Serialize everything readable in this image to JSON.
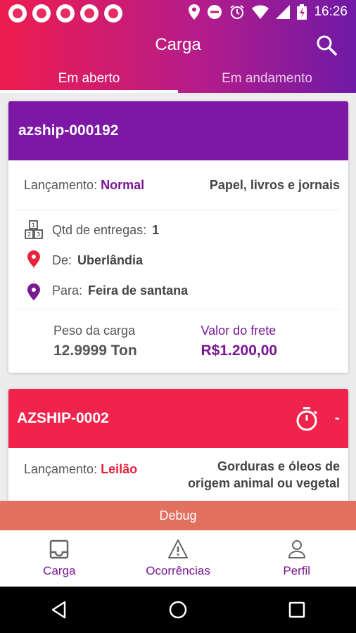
{
  "statusbar": {
    "time": "16:26",
    "left_icons": [
      "app-notification-icon",
      "app-notification-icon",
      "app-notification-icon",
      "app-notification-icon",
      "record-icon"
    ],
    "right_icons": [
      "location-icon",
      "do-not-disturb-icon",
      "alarm-icon",
      "wifi-icon",
      "signal-icon",
      "battery-icon"
    ]
  },
  "appbar": {
    "title": "Carga",
    "search_icon": "search-icon"
  },
  "tabs": [
    {
      "label": "Em aberto",
      "active": true
    },
    {
      "label": "Em andamento",
      "active": false
    }
  ],
  "cards": [
    {
      "id": "azship-000192",
      "header_color": "#7c18a5",
      "launch_label": "Lançamento:",
      "launch_type": "Normal",
      "category": "Papel, livros e jornais",
      "deliveries_label": "Qtd de entregas:",
      "deliveries_value": "1",
      "from_label": "De:",
      "from_value": "Uberlândia",
      "to_label": "Para:",
      "to_value": "Feira de santana",
      "weight_label": "Peso da carga",
      "weight_value": "12.9999 Ton",
      "freight_label": "Valor do frete",
      "freight_value": "R$1.200,00"
    },
    {
      "id": "AZSHIP-0002",
      "header_color": "#f0234c",
      "timer_value": "-",
      "launch_label": "Lançamento:",
      "launch_type": "Leilão",
      "category_line1": "Gorduras e óleos de",
      "category_line2": "origem animal ou vegetal"
    }
  ],
  "debug": {
    "label": "Debug"
  },
  "bottom_nav": [
    {
      "label": "Carga",
      "icon": "inbox-icon"
    },
    {
      "label": "Ocorrências",
      "icon": "warning-icon"
    },
    {
      "label": "Perfil",
      "icon": "person-icon"
    }
  ],
  "system_nav": [
    "back-icon",
    "home-icon",
    "recents-icon"
  ],
  "colors": {
    "gradient_start": "#ee1c4e",
    "gradient_end": "#6f1aa6",
    "purple": "#7a1793",
    "red": "#e8223f",
    "debug": "#e2705f"
  }
}
